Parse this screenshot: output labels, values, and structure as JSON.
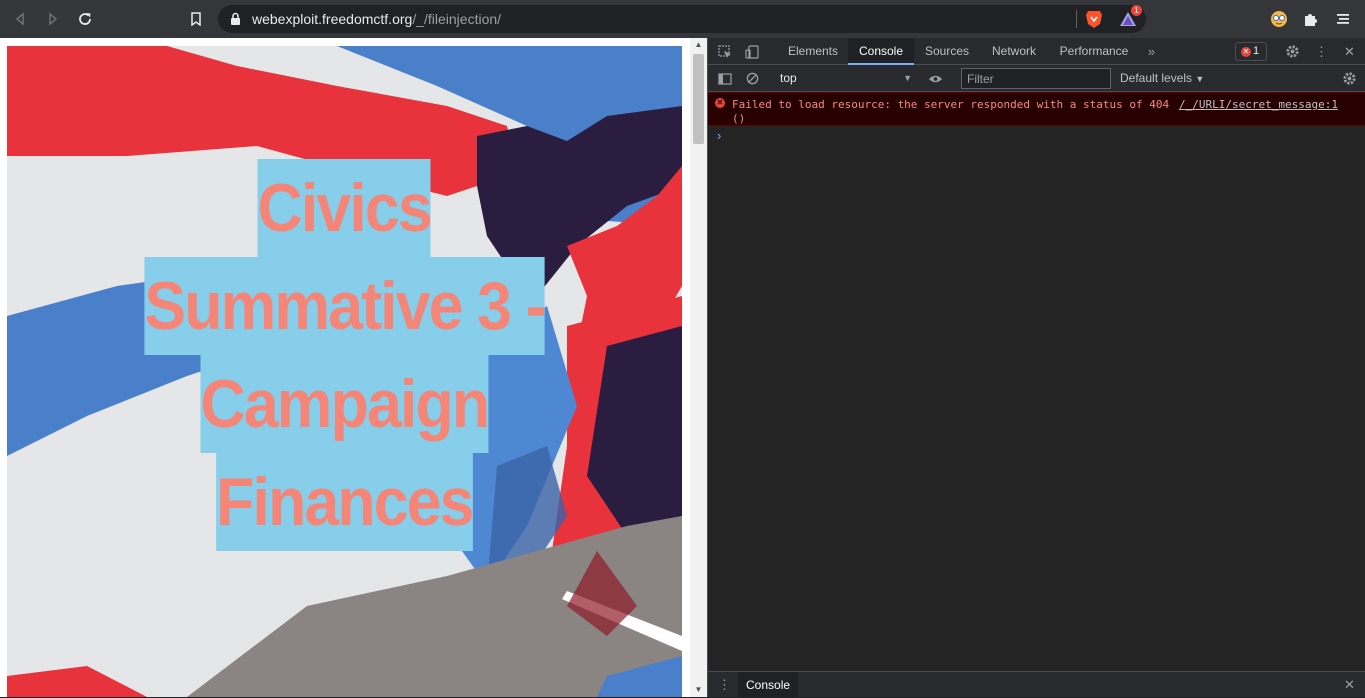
{
  "browser": {
    "url_host": "webexploit.freedomctf.org",
    "url_path": "/_/fileinjection/",
    "extension_badge_count": "1"
  },
  "page": {
    "title_lines": [
      "Civics",
      "Summative 3 -",
      "Campaign",
      "Finances"
    ],
    "colors": {
      "title_text": "#f58577",
      "title_highlight": "#87ceeb",
      "poster_red": "#e8323c",
      "poster_blue": "#4a7fc9",
      "poster_navy": "#2b1d3f",
      "poster_gray": "#8a8583"
    }
  },
  "devtools": {
    "tabs": [
      "Elements",
      "Console",
      "Sources",
      "Network",
      "Performance"
    ],
    "active_tab": "Console",
    "error_count": "1",
    "context": "top",
    "filter_placeholder": "Filter",
    "levels_label": "Default levels",
    "error_message": "Failed to load resource: the server responded with a status of 404\n()",
    "error_source": "/_/URLI/secret_message:1",
    "drawer_tab": "Console"
  },
  "icons": {
    "back": "back-arrow-icon",
    "forward": "forward-arrow-icon",
    "reload": "reload-icon",
    "bookmark": "bookmark-icon",
    "lock": "lock-icon",
    "brave": "brave-shield-icon",
    "rewards": "brave-rewards-icon",
    "profile": "profile-avatar-icon",
    "extensions": "puzzle-icon",
    "menu": "hamburger-menu-icon"
  }
}
